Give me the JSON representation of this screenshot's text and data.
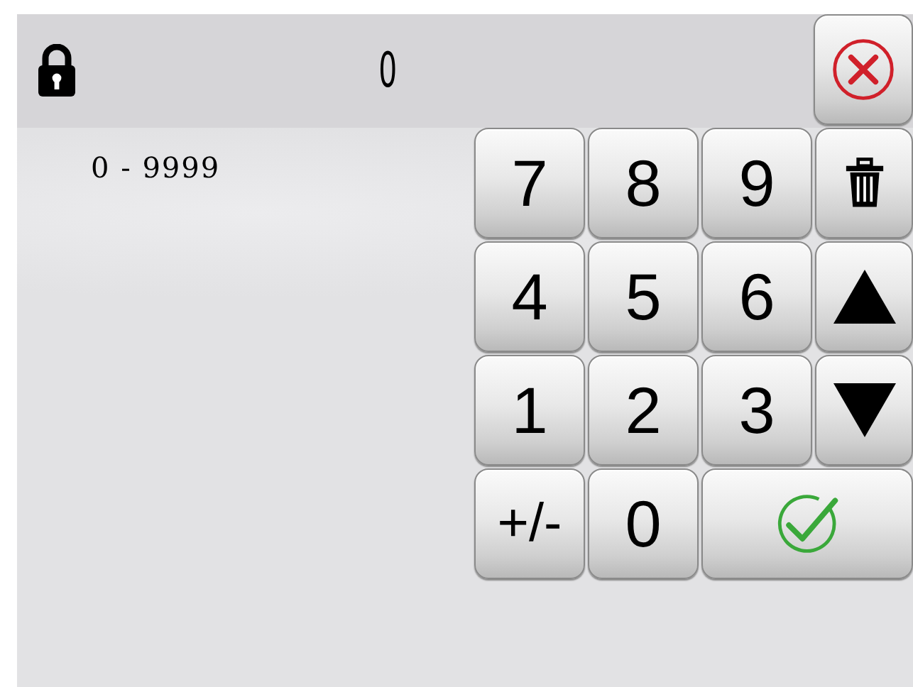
{
  "header": {
    "locked": true,
    "value": "0"
  },
  "range": "0 - 9999",
  "keys": [
    {
      "kind": "text",
      "label": "7"
    },
    {
      "kind": "text",
      "label": "8"
    },
    {
      "kind": "text",
      "label": "9"
    },
    {
      "kind": "delete"
    },
    {
      "kind": "text",
      "label": "4"
    },
    {
      "kind": "text",
      "label": "5"
    },
    {
      "kind": "text",
      "label": "6"
    },
    {
      "kind": "up"
    },
    {
      "kind": "text",
      "label": "1"
    },
    {
      "kind": "text",
      "label": "2"
    },
    {
      "kind": "text",
      "label": "3"
    },
    {
      "kind": "down"
    },
    {
      "kind": "text",
      "label": "+/-"
    },
    {
      "kind": "text",
      "label": "0"
    },
    {
      "kind": "confirm"
    }
  ]
}
